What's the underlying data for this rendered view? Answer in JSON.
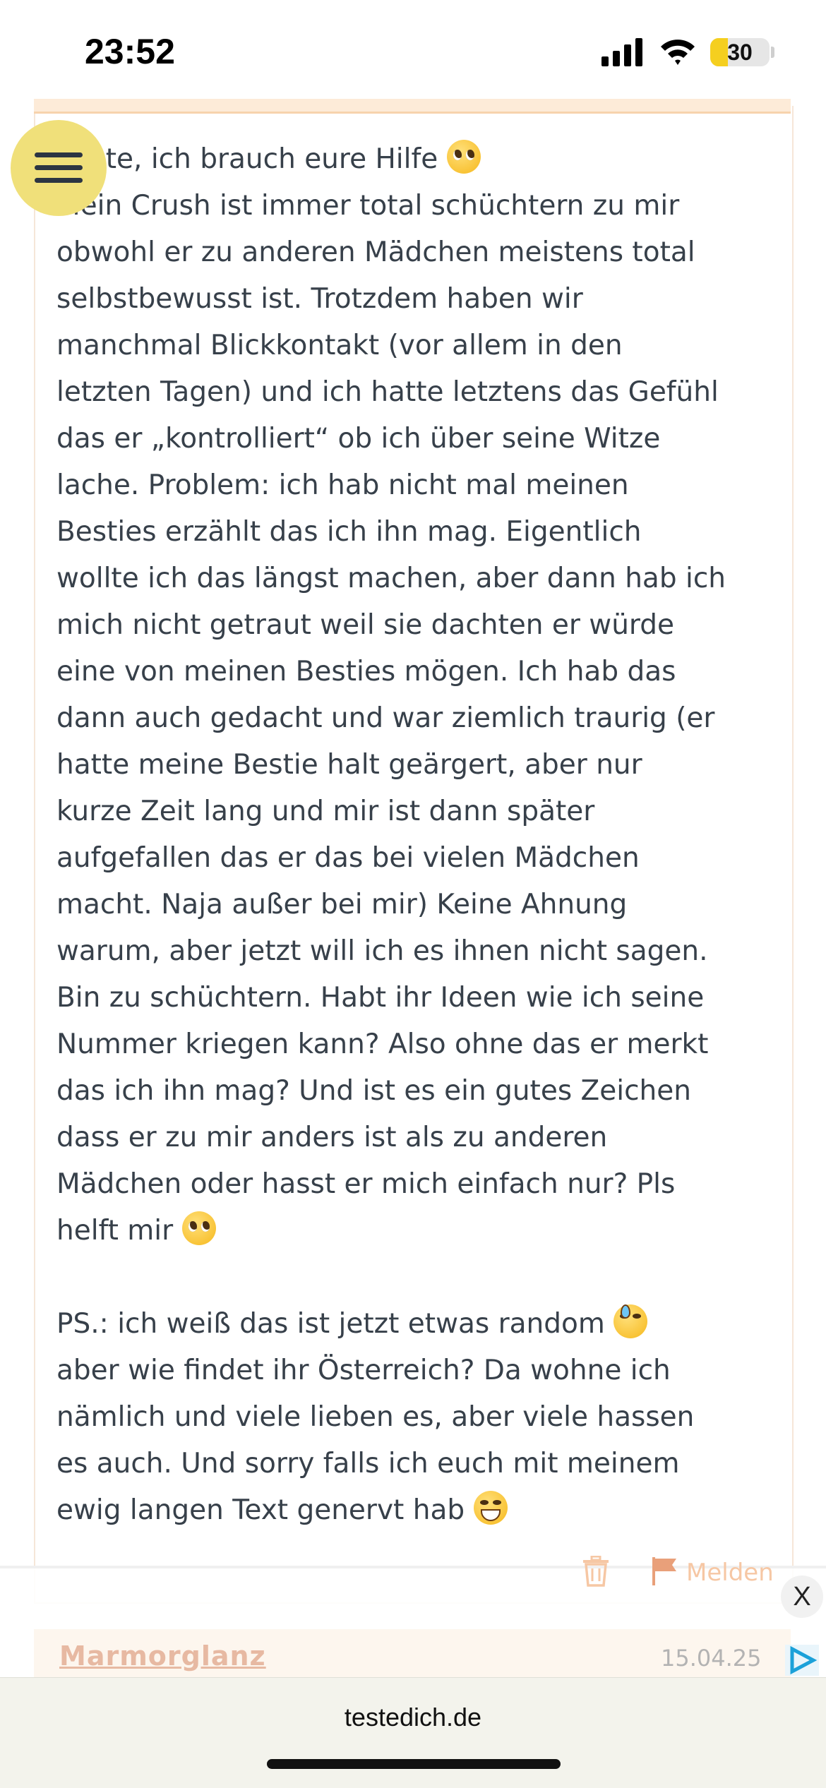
{
  "status_bar": {
    "time": "23:52",
    "battery_percent": "30",
    "battery_level": 0.3
  },
  "post": {
    "lines": [
      "Leute, ich brauch eure Hilfe ",
      "Mein Crush ist immer total schüchtern zu mir",
      "obwohl er zu anderen Mädchen meistens total",
      "selbstbewusst ist. Trotzdem haben wir",
      "manchmal Blickkontakt (vor allem in den",
      "letzten Tagen) und ich hatte letztens das Gefühl",
      "das er „kontrolliert“ ob ich über seine Witze",
      "lache. Problem: ich hab nicht mal meinen",
      "Besties erzählt das ich ihn mag. Eigentlich",
      "wollte ich das längst machen, aber dann hab ich",
      "mich nicht getraut weil sie dachten er würde",
      "eine von meinen Besties mögen. Ich hab das",
      "dann auch gedacht und war ziemlich traurig (er",
      "hatte meine Bestie halt geärgert, aber nur",
      "kurze Zeit lang und mir ist dann später",
      "aufgefallen das er das bei vielen Mädchen",
      "macht. Naja außer bei mir) Keine Ahnung",
      "warum, aber jetzt will ich es ihnen nicht sagen.",
      "Bin zu schüchtern. Habt ihr Ideen wie ich seine",
      "Nummer kriegen kann? Also ohne das er merkt",
      "das ich ihn mag? Und ist es ein gutes Zeichen",
      "dass er zu mir anders ist als zu anderen",
      "Mädchen oder hasst er mich einfach nur? Pls",
      "helft mir ",
      "",
      "PS.: ich weiß das ist jetzt etwas random ",
      "aber wie findet ihr Österreich? Da wohne ich",
      "nämlich und viele lieben es, aber viele hassen",
      "es auch. Und sorry falls ich euch mit meinem",
      "ewig langen Text genervt hab "
    ],
    "emojis": [
      "pleading-face",
      "pleading-face",
      "grinning-sweat-face",
      "beaming-face"
    ],
    "report_label": "Melden"
  },
  "ad": {
    "close_label": "X"
  },
  "next_post": {
    "username": "Marmorglanz",
    "date": "15.04.25"
  },
  "browser": {
    "url": "testedich.de"
  },
  "icons": {
    "menu": "hamburger-menu-icon",
    "delete": "trash-icon",
    "report": "flag-icon",
    "ad_choices": "ad-choices-icon"
  },
  "colors": {
    "menu_button": "#f0e07a",
    "accent_light": "#f6c7a4",
    "header_bg": "#fdebd8"
  }
}
